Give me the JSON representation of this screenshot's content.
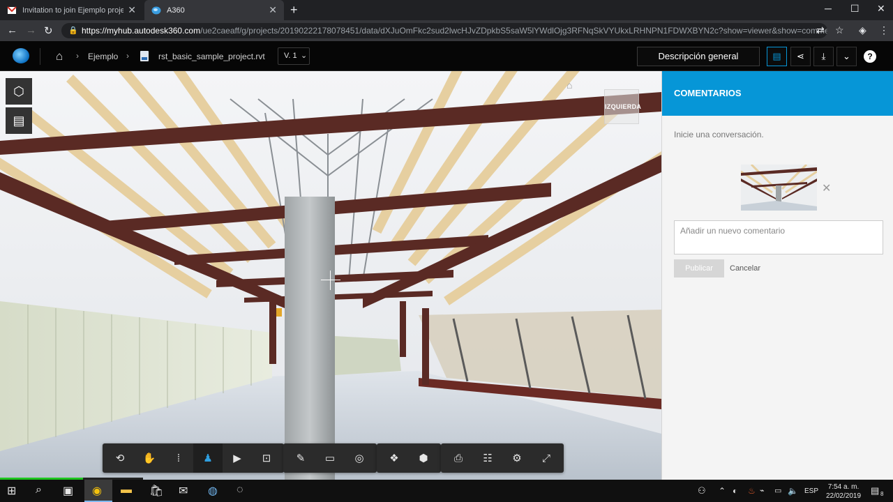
{
  "browser": {
    "tabs": [
      {
        "title": "Invitation to join Ejemplo project",
        "favicon": "gmail-icon",
        "active": false
      },
      {
        "title": "A360",
        "favicon": "a360-icon",
        "active": true
      }
    ],
    "url_host": "https://myhub.autodesk360.com",
    "url_rest": "/ue2caeaff/g/projects/20190222178078451/data/dXJuOmFkc2sud2lwcHJvZDpkbS5saW5lYWdlOjg3RFNqSkVYUkxLRHNPN1FDWXBYN2c?show=viewer&show=comme..."
  },
  "header": {
    "project": "Ejemplo",
    "file_name": "rst_basic_sample_project.rvt",
    "version": "V. 1",
    "overview_label": "Descripción general",
    "help_label": "?"
  },
  "viewer": {
    "viewcube_label": "IZQUIERDA",
    "toolbar_groups": [
      [
        "orbit-icon",
        "pan-icon",
        "first-person-icon",
        "walk-icon",
        "camera-icon",
        "fit-view-icon"
      ],
      [
        "markup-icon",
        "comment-icon",
        "hide-icon"
      ],
      [
        "model-browser-icon",
        "explode-icon"
      ],
      [
        "print-icon",
        "properties-icon",
        "settings-icon",
        "fullscreen-icon"
      ]
    ],
    "active_tool": "walk-icon",
    "load_progress": 0.58
  },
  "comments": {
    "title": "COMENTARIOS",
    "prompt": "Inicie una conversación.",
    "placeholder": "Añadir un nuevo comentario",
    "publish_label": "Publicar",
    "cancel_label": "Cancelar"
  },
  "taskbar": {
    "language": "ESP",
    "time": "7:54 a. m.",
    "date": "22/02/2019",
    "notifications": "8"
  },
  "colors": {
    "accent": "#0696d7",
    "header_bg": "#060606",
    "steel": "#5a2a24",
    "timber": "#e6cfa0"
  }
}
